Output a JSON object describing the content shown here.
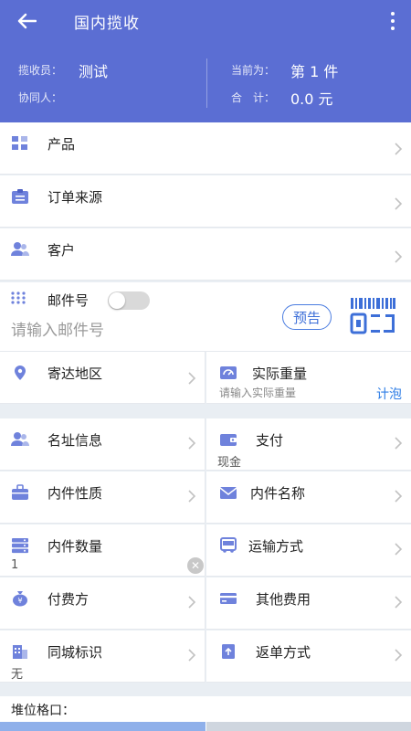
{
  "header": {
    "title": "国内揽收"
  },
  "summary": {
    "collector_label": "揽收员：",
    "collector_value": "测试",
    "helper_label": "协同人：",
    "current_label": "当前为：",
    "current_value": "第 1 件",
    "total_label": "合　计：",
    "total_value": "0.0 元"
  },
  "rows": {
    "product": "产品",
    "order_source": "订单来源",
    "customer": "客户"
  },
  "mail": {
    "label": "邮件号",
    "placeholder": "请输入邮件号",
    "preview_label": "预告"
  },
  "grid": {
    "region": {
      "label": "寄达地区"
    },
    "weight": {
      "label": "实际重量",
      "placeholder": "请输入实际重量",
      "action": "计泡"
    },
    "address": {
      "label": "名址信息"
    },
    "payment": {
      "label": "支付",
      "value": "现金"
    },
    "inner_nature": {
      "label": "内件性质"
    },
    "inner_name": {
      "label": "内件名称"
    },
    "inner_qty": {
      "label": "内件数量",
      "value": "1"
    },
    "transport": {
      "label": "运输方式"
    },
    "payer": {
      "label": "付费方"
    },
    "other_fees": {
      "label": "其他费用"
    },
    "city_mark": {
      "label": "同城标识",
      "value": "无"
    },
    "return_method": {
      "label": "返单方式"
    }
  },
  "footer": {
    "label": "堆位格口："
  },
  "colors": {
    "primary": "#5b6ed3",
    "icon": "#6f82dc",
    "link": "#2f7ee6"
  }
}
